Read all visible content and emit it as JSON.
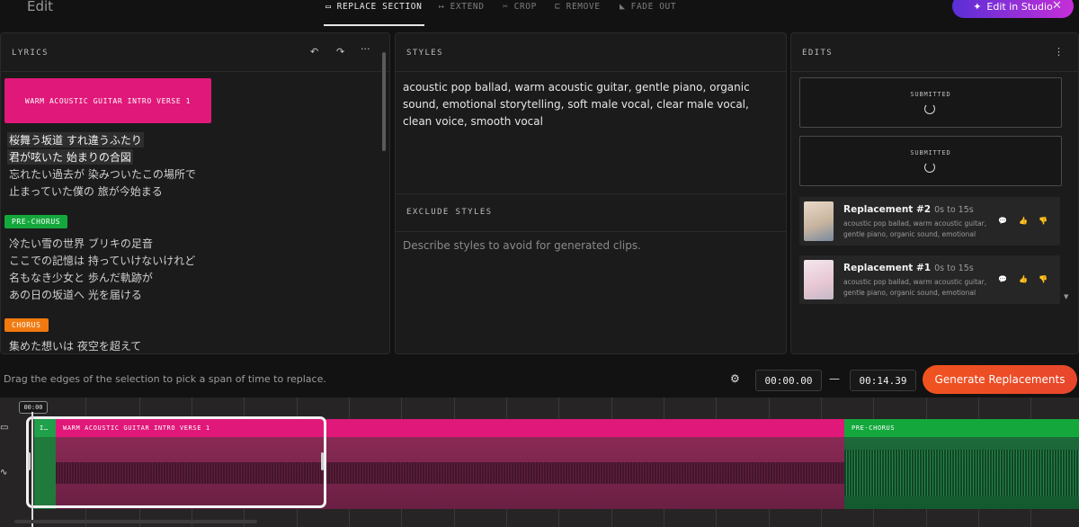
{
  "header": {
    "title": "Edit",
    "tabs": [
      {
        "icon": "▭",
        "label": "REPLACE SECTION"
      },
      {
        "icon": "↦",
        "label": "EXTEND"
      },
      {
        "icon": "✂",
        "label": "CROP"
      },
      {
        "icon": "⊏",
        "label": "REMOVE"
      },
      {
        "icon": "◣",
        "label": "FADE OUT"
      }
    ],
    "studio_button": "Edit in Studio",
    "close": "✕"
  },
  "lyrics": {
    "heading": "LYRICS",
    "undo": "↶",
    "redo": "↷",
    "more": "···",
    "tag_verse": "WARM ACOUSTIC GUITAR INTRO VERSE 1",
    "verse_lines": [
      "桜舞う坂道 すれ違うふたり",
      "君が呟いた 始まりの合図",
      "忘れたい過去が 染みついたこの場所で",
      "止まっていた僕の 旅が今始まる"
    ],
    "tag_prechorus": "PRE-CHORUS",
    "prechorus_lines": [
      "冷たい雪の世界 ブリキの足音",
      "ここでの記憶は 持っていけないけれど",
      "名もなき少女と 歩んだ軌跡が",
      "あの日の坂道へ 光を届ける"
    ],
    "tag_chorus": "CHORUS",
    "chorus_lines": [
      "集めた想いは 夜空を超えて"
    ]
  },
  "styles": {
    "heading": "STYLES",
    "text": "acoustic pop ballad, warm acoustic guitar, gentle piano, organic sound, emotional storytelling, soft male vocal, clear male vocal, clean voice, smooth vocal",
    "exclude_heading": "EXCLUDE STYLES",
    "exclude_placeholder": "Describe styles to avoid for generated clips."
  },
  "edits": {
    "heading": "EDITS",
    "more": "⋮",
    "submitted": [
      "SUBMITTED",
      "SUBMITTED"
    ],
    "replacements": [
      {
        "title": "Replacement #2",
        "range": "0s to 15s",
        "desc": "acoustic pop ballad, warm acoustic guitar, gentle piano, organic sound, emotional"
      },
      {
        "title": "Replacement #1",
        "range": "0s to 15s",
        "desc": "acoustic pop ballad, warm acoustic guitar, gentle piano, organic sound, emotional"
      }
    ]
  },
  "selection": {
    "hint": "Drag the edges of the selection to pick a span of time to replace.",
    "start": "00:00.00",
    "end": "00:14.39",
    "dash": "—",
    "generate": "Generate Replacements"
  },
  "timeline": {
    "playhead_time": "00:00",
    "segments": [
      {
        "label": "I…",
        "color": "#1fa04a"
      },
      {
        "label": "WARM ACOUSTIC GUITAR INTRO   VERSE 1",
        "color": "#e0187a"
      },
      {
        "label": "PRE-CHORUS",
        "color": "#14a83c"
      }
    ]
  },
  "colors": {
    "pink": "#e0187a",
    "green": "#14a83c",
    "orange": "#f07a10",
    "accent": "#f0531f"
  }
}
